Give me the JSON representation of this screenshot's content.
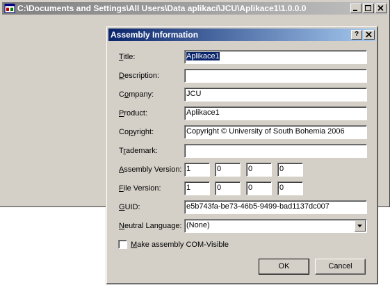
{
  "main_window": {
    "title": "C:\\Documents and Settings\\All Users\\Data aplikací\\JCU\\Aplikace1\\1.0.0.0"
  },
  "dialog": {
    "title": "Assembly Information",
    "help_glyph": "?",
    "close_glyph": "X",
    "fields": {
      "title": {
        "label_u": "T",
        "label_rest": "itle:",
        "value": "Aplikace1"
      },
      "description": {
        "label_u": "D",
        "label_rest": "escription:",
        "value": ""
      },
      "company": {
        "label_pre": "C",
        "label_u": "o",
        "label_rest": "mpany:",
        "value": "JCU"
      },
      "product": {
        "label_u": "P",
        "label_rest": "roduct:",
        "value": "Aplikace1"
      },
      "copyright": {
        "label_pre": "Co",
        "label_u": "p",
        "label_rest": "yright:",
        "value": "Copyright © University of South Bohemia 2006"
      },
      "trademark": {
        "label_pre": "T",
        "label_u": "r",
        "label_rest": "ademark:",
        "value": ""
      },
      "assembly_version": {
        "label_u": "A",
        "label_rest": "ssembly Version:",
        "values": [
          "1",
          "0",
          "0",
          "0"
        ]
      },
      "file_version": {
        "label_u": "F",
        "label_rest": "ile Version:",
        "values": [
          "1",
          "0",
          "0",
          "0"
        ]
      },
      "guid": {
        "label_u": "G",
        "label_rest": "UID:",
        "value": "e5b743fa-be73-46b5-9499-bad1137dc007"
      },
      "neutral_language": {
        "label_u": "N",
        "label_rest": "eutral Language:",
        "value": "(None)"
      }
    },
    "com_visible": {
      "label_u": "M",
      "label_rest": "ake assembly COM-Visible",
      "checked": false
    },
    "ok_label": "OK",
    "cancel_label": "Cancel"
  },
  "colors": {
    "active_title_start": "#0a246a",
    "active_title_end": "#a6caf0",
    "inactive_title_start": "#808080",
    "inactive_title_end": "#c0c0c0",
    "face": "#d4d0c8"
  }
}
